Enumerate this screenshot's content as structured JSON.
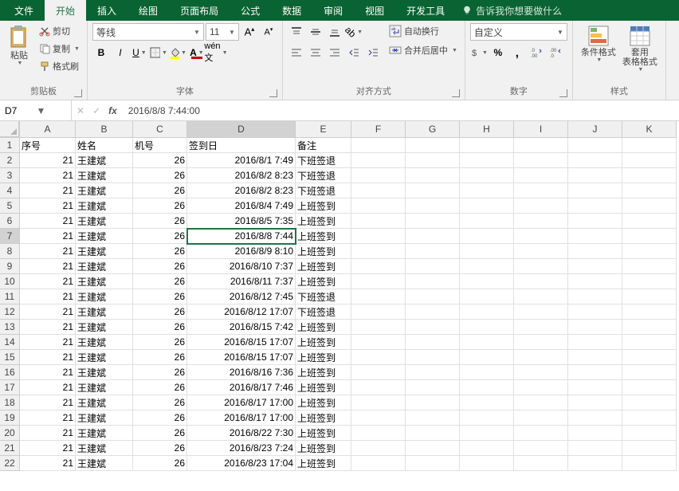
{
  "tabs": {
    "file": "文件",
    "home": "开始",
    "insert": "插入",
    "draw": "绘图",
    "layout": "页面布局",
    "formulas": "公式",
    "data": "数据",
    "review": "审阅",
    "view": "视图",
    "dev": "开发工具",
    "tellme": "告诉我你想要做什么"
  },
  "ribbon": {
    "clipboard": {
      "paste": "粘贴",
      "cut": "剪切",
      "copy": "复制",
      "painter": "格式刷",
      "label": "剪贴板"
    },
    "font": {
      "name": "等线",
      "size": "11",
      "label": "字体",
      "bold": "B",
      "italic": "I",
      "underline": "U"
    },
    "align": {
      "wrap": "自动换行",
      "merge": "合并后居中",
      "label": "对齐方式"
    },
    "number": {
      "format": "自定义",
      "label": "数字"
    },
    "styles": {
      "cond": "条件格式",
      "table": "套用\n表格格式",
      "label": "样式"
    }
  },
  "namebox": "D7",
  "formula": "2016/8/8  7:44:00",
  "cols": [
    "A",
    "B",
    "C",
    "D",
    "E",
    "F",
    "G",
    "H",
    "I",
    "J",
    "K"
  ],
  "headerRow": [
    "序号",
    "姓名",
    "机号",
    "签到日",
    "备注"
  ],
  "rows": [
    [
      "21",
      "王建斌",
      "26",
      "2016/8/1 7:49",
      "下班签退"
    ],
    [
      "21",
      "王建斌",
      "26",
      "2016/8/2 8:23",
      "下班签退"
    ],
    [
      "21",
      "王建斌",
      "26",
      "2016/8/2 8:23",
      "下班签退"
    ],
    [
      "21",
      "王建斌",
      "26",
      "2016/8/4 7:49",
      "上班签到"
    ],
    [
      "21",
      "王建斌",
      "26",
      "2016/8/5 7:35",
      "上班签到"
    ],
    [
      "21",
      "王建斌",
      "26",
      "2016/8/8 7:44",
      "上班签到"
    ],
    [
      "21",
      "王建斌",
      "26",
      "2016/8/9 8:10",
      "上班签到"
    ],
    [
      "21",
      "王建斌",
      "26",
      "2016/8/10 7:37",
      "上班签到"
    ],
    [
      "21",
      "王建斌",
      "26",
      "2016/8/11 7:37",
      "上班签到"
    ],
    [
      "21",
      "王建斌",
      "26",
      "2016/8/12 7:45",
      "下班签退"
    ],
    [
      "21",
      "王建斌",
      "26",
      "2016/8/12 17:07",
      "下班签退"
    ],
    [
      "21",
      "王建斌",
      "26",
      "2016/8/15 7:42",
      "上班签到"
    ],
    [
      "21",
      "王建斌",
      "26",
      "2016/8/15 17:07",
      "上班签到"
    ],
    [
      "21",
      "王建斌",
      "26",
      "2016/8/15 17:07",
      "上班签到"
    ],
    [
      "21",
      "王建斌",
      "26",
      "2016/8/16 7:36",
      "上班签到"
    ],
    [
      "21",
      "王建斌",
      "26",
      "2016/8/17 7:46",
      "上班签到"
    ],
    [
      "21",
      "王建斌",
      "26",
      "2016/8/17 17:00",
      "上班签到"
    ],
    [
      "21",
      "王建斌",
      "26",
      "2016/8/17 17:00",
      "上班签到"
    ],
    [
      "21",
      "王建斌",
      "26",
      "2016/8/22 7:30",
      "上班签到"
    ],
    [
      "21",
      "王建斌",
      "26",
      "2016/8/23 7:24",
      "上班签到"
    ],
    [
      "21",
      "王建斌",
      "26",
      "2016/8/23 17:04",
      "上班签到"
    ]
  ],
  "activeRow": 7,
  "activeCol": "D"
}
